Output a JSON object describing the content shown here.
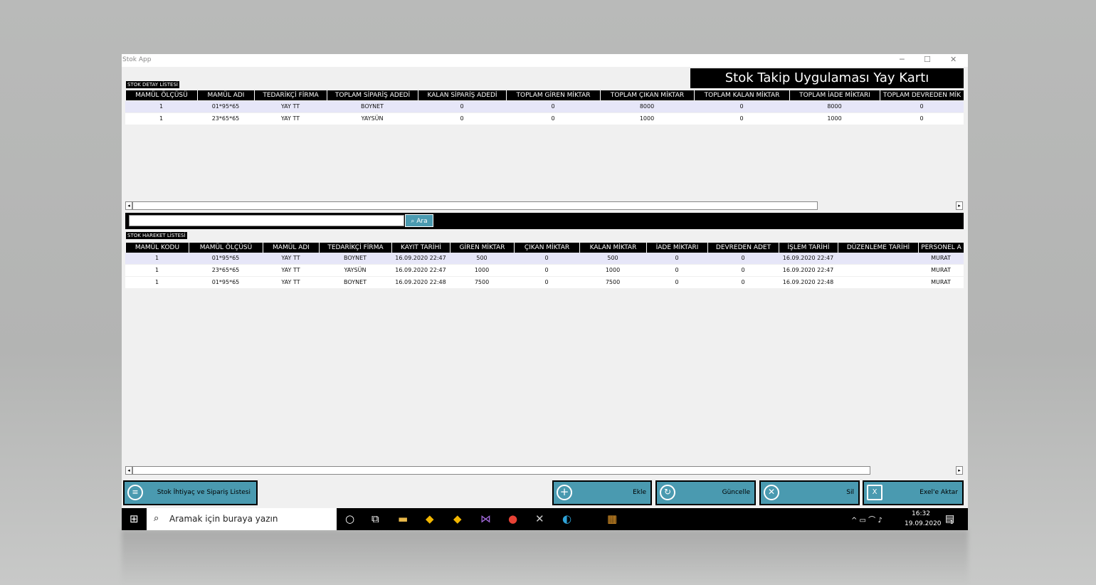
{
  "window": {
    "title": "Stok App",
    "banner": "Stok Takip Uygulaması  Yay Kartı"
  },
  "detail": {
    "label": "STOK DETAY LİSTESİ",
    "columns": [
      "MAMÜL ÖLÇÜSÜ",
      "MAMÜL ADI",
      "TEDARİKÇİ FİRMA",
      "TOPLAM SİPARİŞ ADEDİ",
      "KALAN SİPARİŞ ADEDİ",
      "TOPLAM GİREN MİKTAR",
      "TOPLAM ÇIKAN MİKTAR",
      "TOPLAM KALAN MİKTAR",
      "TOPLAM İADE MİKTARI",
      "TOPLAM DEVREDEN MİK"
    ],
    "rows": [
      [
        "1",
        "01*95*65",
        "YAY TT",
        "BOYNET",
        "0",
        "0",
        "8000",
        "0",
        "8000",
        "0"
      ],
      [
        "1",
        "23*65*65",
        "YAY TT",
        "YAYSÜN",
        "0",
        "0",
        "1000",
        "0",
        "1000",
        "0"
      ]
    ]
  },
  "search": {
    "placeholder": "",
    "button": "Ara"
  },
  "movement": {
    "label": "STOK HAREKET LİSTESİ",
    "columns": [
      "MAMÜL KODU",
      "MAMÜL ÖLÇÜSÜ",
      "MAMÜL ADI",
      "TEDARİKÇİ FİRMA",
      "KAYIT TARİHİ",
      "GİREN MİKTAR",
      "ÇIKAN MİKTAR",
      "KALAN MİKTAR",
      "İADE MİKTARI",
      "DEVREDEN ADET",
      "İŞLEM TARİHİ",
      "DÜZENLEME TARİHİ",
      "PERSONEL A"
    ],
    "rows": [
      [
        "1",
        "01*95*65",
        "YAY TT",
        "BOYNET",
        "16.09.2020 22:47",
        "500",
        "0",
        "500",
        "0",
        "0",
        "16.09.2020 22:47",
        "",
        "MURAT"
      ],
      [
        "1",
        "23*65*65",
        "YAY TT",
        "YAYSÜN",
        "16.09.2020 22:47",
        "1000",
        "0",
        "1000",
        "0",
        "0",
        "16.09.2020 22:47",
        "",
        "MURAT"
      ],
      [
        "1",
        "01*95*65",
        "YAY TT",
        "BOYNET",
        "16.09.2020 22:48",
        "7500",
        "0",
        "7500",
        "0",
        "0",
        "16.09.2020 22:48",
        "",
        "MURAT"
      ]
    ]
  },
  "buttons": {
    "list": "Stok İhtiyaç ve Sipariş Listesi",
    "add": "Ekle",
    "update": "Güncelle",
    "delete": "Sil",
    "export": "Exel'e Aktar"
  },
  "taskbar": {
    "search_placeholder": "Aramak için buraya yazın",
    "time": "16:32",
    "date": "19.09.2020",
    "notification_count": "1"
  },
  "colors": {
    "accent": "#4a9ab0",
    "header": "#000000",
    "selected_row": "#e6e6f8"
  }
}
